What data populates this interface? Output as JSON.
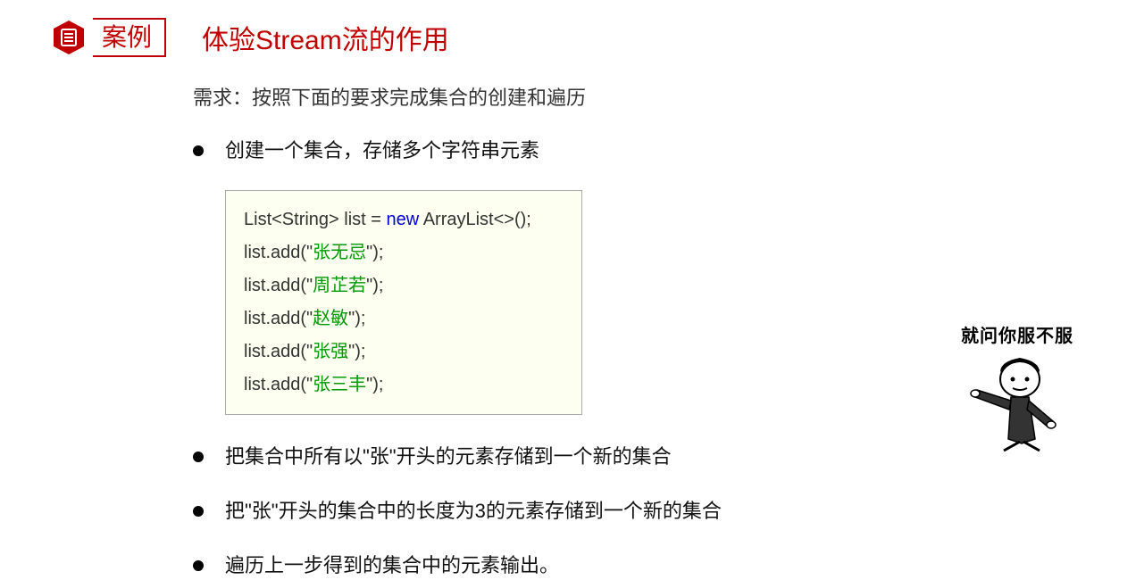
{
  "header": {
    "case_label": "案例",
    "title": "体验Stream流的作用"
  },
  "requirement": "需求：按照下面的要求完成集合的创建和遍历",
  "bullets": [
    "创建一个集合，存储多个字符串元素",
    "把集合中所有以\"张\"开头的元素存储到一个新的集合",
    "把\"张\"开头的集合中的长度为3的元素存储到一个新的集合",
    "遍历上一步得到的集合中的元素输出。"
  ],
  "code": {
    "line1_pre": "List<String> list = ",
    "line1_kw": "new",
    "line1_post": " ArrayList<>();",
    "add_prefix": "list.add(\"",
    "add_suffix": "\");",
    "names": [
      "张无忌",
      "周芷若",
      "赵敏",
      "张强",
      "张三丰"
    ]
  },
  "meme": {
    "text": "就问你服不服"
  }
}
